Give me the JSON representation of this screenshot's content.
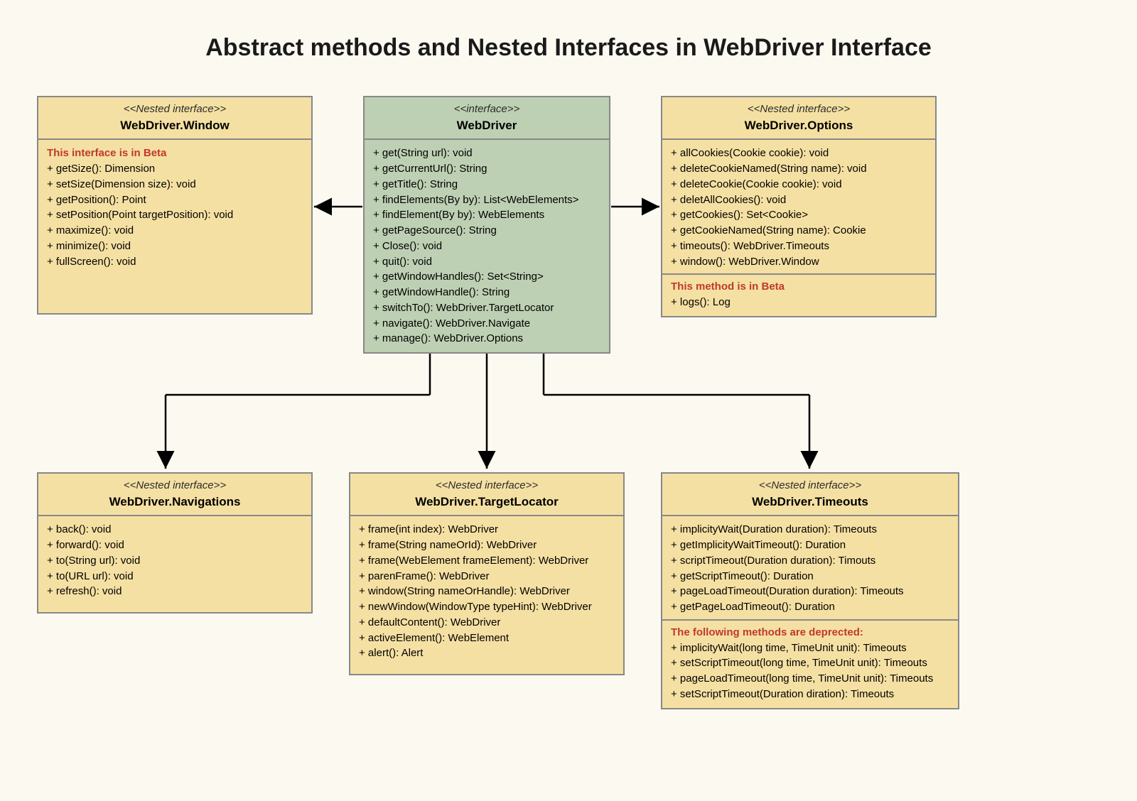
{
  "title": "Abstract methods and Nested Interfaces in WebDriver Interface",
  "stereotypes": {
    "nested": "<<Nested interface>>",
    "interface": "<<interface>>",
    "nested_mixed": "<<Nested interface>>"
  },
  "boxes": {
    "window": {
      "name": "WebDriver.Window",
      "note": "This interface is in Beta",
      "methods": [
        "+ getSize(): Dimension",
        "+ setSize(Dimension size): void",
        "+ getPosition(): Point",
        "+ setPosition(Point targetPosition): void",
        "+ maximize(): void",
        "+ minimize(): void",
        "+ fullScreen(): void"
      ]
    },
    "webdriver": {
      "name": "WebDriver",
      "methods": [
        "+ get(String url): void",
        "+ getCurrentUrl(): String",
        "+ getTitle(): String",
        "+ findElements(By by): List<WebElements>",
        "+ findElement(By by): WebElements",
        "+ getPageSource(): String",
        "+ Close(): void",
        "+ quit(): void",
        "+ getWindowHandles(): Set<String>",
        "+ getWindowHandle(): String",
        "+ switchTo(): WebDriver.TargetLocator",
        "+ navigate(): WebDriver.Navigate",
        "+ manage(): WebDriver.Options"
      ]
    },
    "options": {
      "name": "WebDriver.Options",
      "methods": [
        "+ allCookies(Cookie cookie): void",
        "+ deleteCookieNamed(String name): void",
        "+ deleteCookie(Cookie cookie): void",
        "+ deletAllCookies(): void",
        "+ getCookies(): Set<Cookie>",
        "+ getCookieNamed(String name): Cookie",
        "+ timeouts(): WebDriver.Timeouts",
        "+ window(): WebDriver.Window"
      ],
      "note": "This method is in Beta",
      "extra": [
        "+ logs(): Log"
      ]
    },
    "navigations": {
      "name": "WebDriver.Navigations",
      "methods": [
        "+ back(): void",
        "+ forward(): void",
        "+ to(String url): void",
        "+ to(URL url): void",
        "+ refresh(): void"
      ]
    },
    "targetlocator": {
      "name": "WebDriver.TargetLocator",
      "methods": [
        "+ frame(int index): WebDriver",
        "+ frame(String nameOrId): WebDriver",
        "+ frame(WebElement frameElement): WebDriver",
        "+ parenFrame(): WebDriver",
        "+ window(String nameOrHandle): WebDriver",
        "+ newWindow(WindowType typeHint): WebDriver",
        "+ defaultContent(): WebDriver",
        "+ activeElement(): WebElement",
        "+ alert(): Alert"
      ]
    },
    "timeouts": {
      "name": "WebDriver.Timeouts",
      "methods": [
        "+ implicityWait(Duration duration): Timeouts",
        "+ getImplicityWaitTimeout(): Duration",
        "+ scriptTimeout(Duration duration): Timouts",
        "+ getScriptTimeout(): Duration",
        "+ pageLoadTimeout(Duration duration): Timeouts",
        "+ getPageLoadTimeout(): Duration"
      ],
      "note": "The following methods are deprected:",
      "extra": [
        "+ implicityWait(long time, TimeUnit unit): Timeouts",
        "+ setScriptTimeout(long time, TimeUnit unit): Timeouts",
        "+ pageLoadTimeout(long time, TimeUnit unit): Timeouts",
        "+ setScriptTimeout(Duration diration): Timeouts"
      ]
    }
  }
}
